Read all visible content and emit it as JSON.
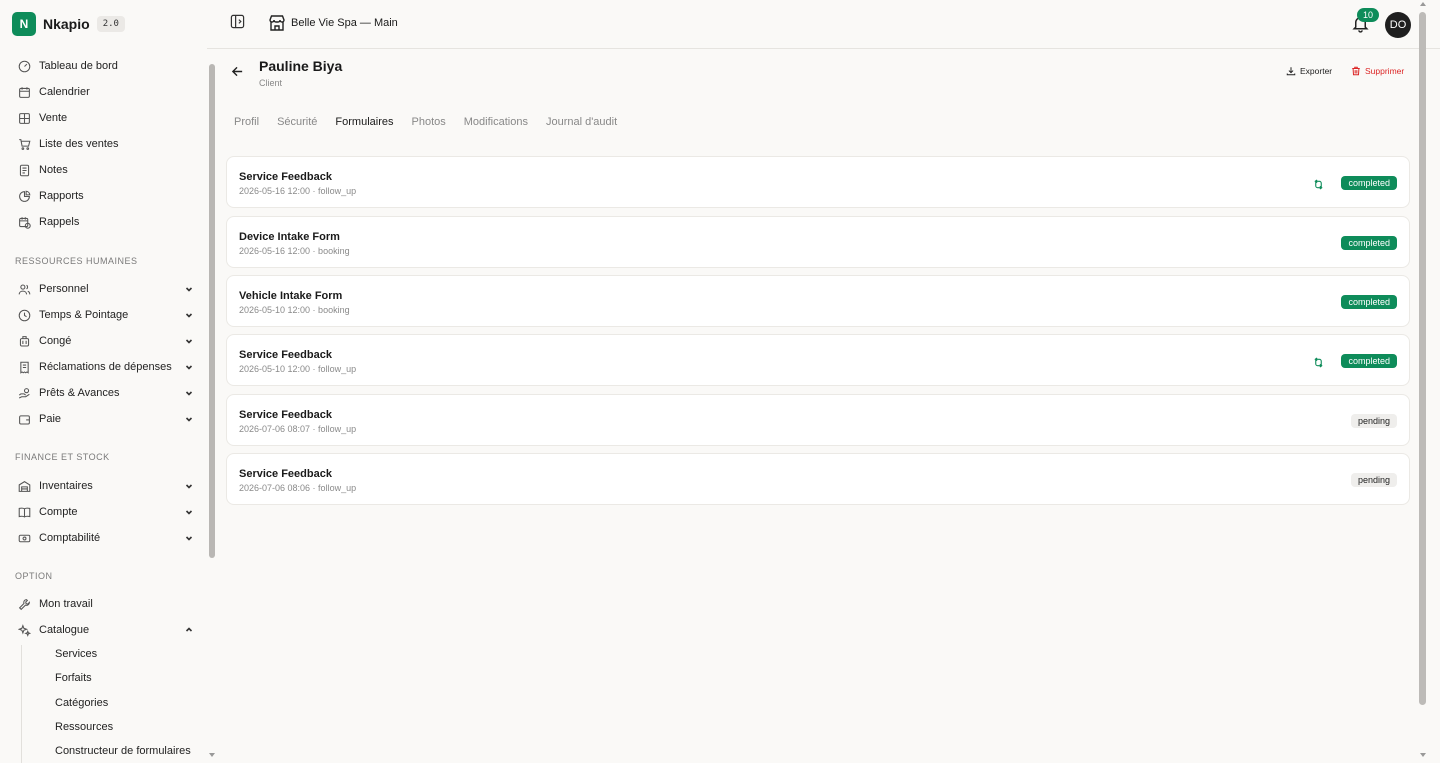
{
  "brand": {
    "logo_letter": "N",
    "name": "Nkapio",
    "version": "2.0"
  },
  "header": {
    "store_name": "Belle Vie Spa — Main",
    "notifications": "10",
    "avatar_initials": "DO"
  },
  "sidebar": {
    "main_items": [
      {
        "label": "Tableau de bord",
        "icon": "gauge-icon"
      },
      {
        "label": "Calendrier",
        "icon": "calendar-icon"
      },
      {
        "label": "Vente",
        "icon": "pos-grid-icon"
      },
      {
        "label": "Liste des ventes",
        "icon": "cart-icon"
      },
      {
        "label": "Notes",
        "icon": "notes-icon"
      },
      {
        "label": "Rapports",
        "icon": "pie-chart-icon"
      },
      {
        "label": "Rappels",
        "icon": "calendar-clock-icon"
      }
    ],
    "sections": {
      "hr": "RESSOURCES HUMAINES",
      "finance": "FINANCE ET STOCK",
      "option": "OPTION"
    },
    "hr_items": [
      {
        "label": "Personnel",
        "icon": "users-icon"
      },
      {
        "label": "Temps & Pointage",
        "icon": "clock-icon"
      },
      {
        "label": "Congé",
        "icon": "luggage-icon"
      },
      {
        "label": "Réclamations de dépenses",
        "icon": "receipt-icon"
      },
      {
        "label": "Prêts & Avances",
        "icon": "hand-coins-icon"
      },
      {
        "label": "Paie",
        "icon": "wallet-icon"
      }
    ],
    "finance_items": [
      {
        "label": "Inventaires",
        "icon": "warehouse-icon"
      },
      {
        "label": "Compte",
        "icon": "book-icon"
      },
      {
        "label": "Comptabilité",
        "icon": "banknote-icon"
      }
    ],
    "option_items": [
      {
        "label": "Mon travail",
        "icon": "wrench-icon"
      },
      {
        "label": "Catalogue",
        "icon": "sparkles-icon"
      }
    ],
    "catalogue_sub": [
      "Services",
      "Forfaits",
      "Catégories",
      "Ressources",
      "Constructeur de formulaires"
    ]
  },
  "page": {
    "title": "Pauline Biya",
    "subtitle": "Client",
    "export_label": "Exporter",
    "delete_label": "Supprimer",
    "tabs": [
      "Profil",
      "Sécurité",
      "Formulaires",
      "Photos",
      "Modifications",
      "Journal d'audit"
    ],
    "active_tab": "Formulaires"
  },
  "forms": [
    {
      "title": "Service Feedback",
      "meta": "2026-05-16 12:00 · follow_up",
      "status": "completed",
      "synced": true
    },
    {
      "title": "Device Intake Form",
      "meta": "2026-05-16 12:00 · booking",
      "status": "completed",
      "synced": false
    },
    {
      "title": "Vehicle Intake Form",
      "meta": "2026-05-10 12:00 · booking",
      "status": "completed",
      "synced": false
    },
    {
      "title": "Service Feedback",
      "meta": "2026-05-10 12:00 · follow_up",
      "status": "completed",
      "synced": true
    },
    {
      "title": "Service Feedback",
      "meta": "2026-07-06 08:07 · follow_up",
      "status": "pending",
      "synced": false
    },
    {
      "title": "Service Feedback",
      "meta": "2026-07-06 08:06 · follow_up",
      "status": "pending",
      "synced": false
    }
  ],
  "colors": {
    "accent": "#0e8c5a",
    "danger": "#dc2626",
    "background": "#faf9f7"
  }
}
